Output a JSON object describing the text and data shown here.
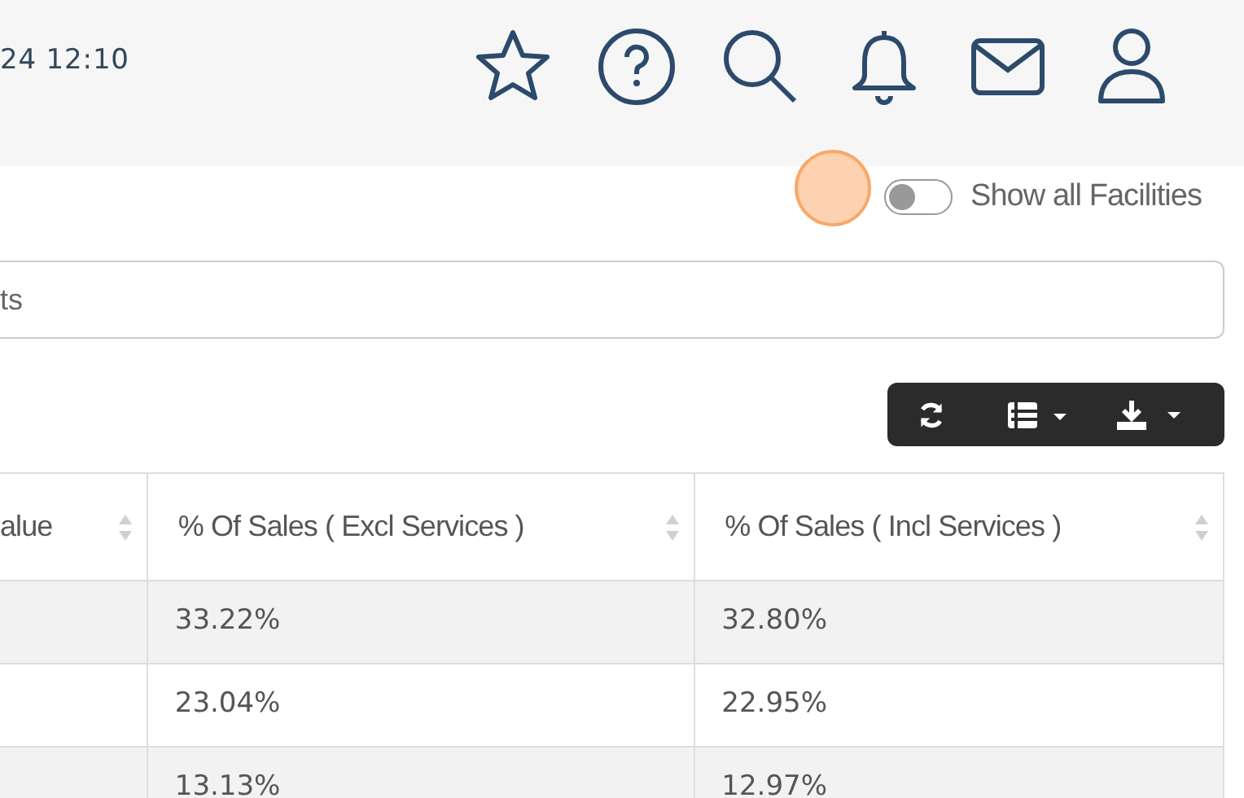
{
  "header": {
    "datetime": "24 12:10"
  },
  "facilities_toggle": {
    "label": "Show all Facilities",
    "on": false
  },
  "search": {
    "value": "ts"
  },
  "table": {
    "columns": [
      "alue",
      "% Of Sales ( Excl Services )",
      "% Of Sales ( Incl Services )"
    ],
    "rows": [
      {
        "excl": "33.22%",
        "incl": "32.80%"
      },
      {
        "excl": "23.04%",
        "incl": "22.95%"
      },
      {
        "excl": "13.13%",
        "incl": "12.97%"
      }
    ]
  }
}
